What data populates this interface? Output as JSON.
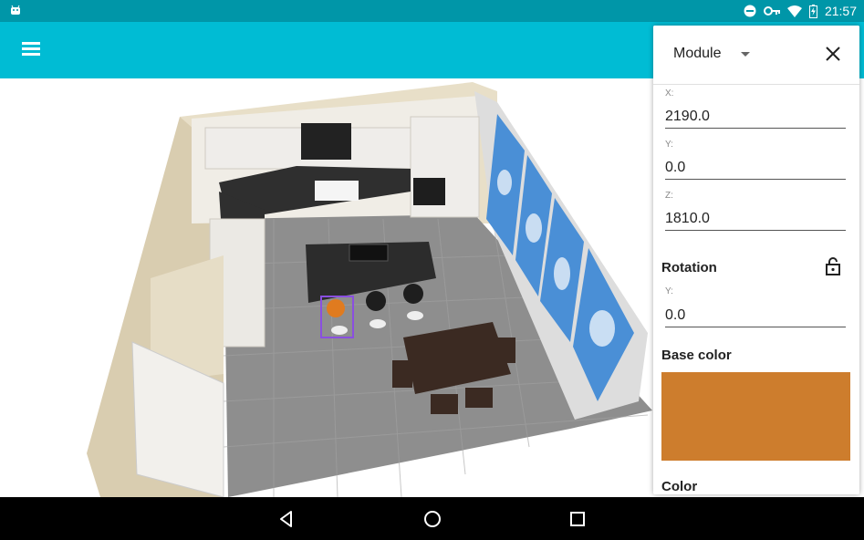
{
  "status_bar": {
    "time": "21:57",
    "icons": [
      "android-icon",
      "do-not-disturb-icon",
      "vpn-key-icon",
      "wifi-icon",
      "battery-charging-icon"
    ]
  },
  "app_bar": {
    "menu_icon": "hamburger-menu-icon"
  },
  "panel": {
    "dropdown_value": "Module",
    "close_icon": "close-icon",
    "x_label": "X:",
    "x_value": "2190.0",
    "y_label": "Y:",
    "y_value": "0.0",
    "z_label": "Z:",
    "z_value": "1810.0",
    "rotation_title": "Rotation",
    "rotation_lock_icon": "lock-open-icon",
    "rotation_y_label": "Y:",
    "rotation_y_value": "0.0",
    "base_color_title": "Base color",
    "base_color_hex": "#cd7d2d",
    "color_title": "Color"
  },
  "navigation_bar": {
    "icons": [
      "back-icon",
      "home-icon",
      "recents-icon"
    ]
  },
  "colors": {
    "status_bar": "#0096a8",
    "app_bar": "#00bcd4",
    "floor": "#8e8e8e",
    "countertop": "#2f2f2f",
    "wood_wall": "#e6ddc6",
    "table": "#3b2a22",
    "selected_stool": "#e07b1f",
    "selection_outline": "#8a4fe0"
  }
}
